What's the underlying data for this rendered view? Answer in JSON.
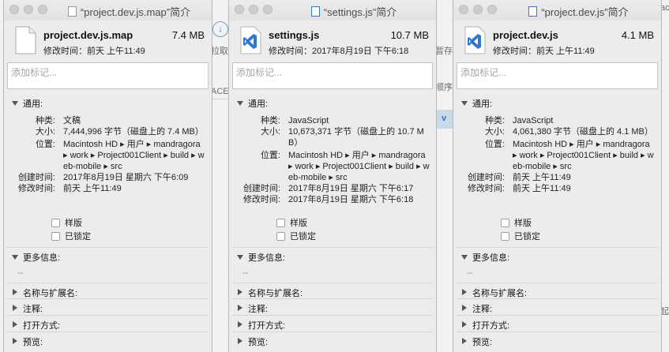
{
  "windows": [
    {
      "title": "“project.dev.js.map”简介",
      "icon": "blank-document-icon",
      "file_name": "project.dev.js.map",
      "file_size": "7.4 MB",
      "modified_line": "修改时间：前天 上午11:49",
      "tags_placeholder": "添加标记...",
      "general_label": "通用:",
      "kind_label": "种类:",
      "kind": "文稿",
      "size_label": "大小:",
      "size": "7,444,996 字节（磁盘上的 7.4 MB）",
      "where_label": "位置:",
      "where": "Macintosh HD ▸ 用户 ▸ mandragora ▸ work ▸ Project001Client ▸ build ▸ web-mobile ▸ src",
      "created_label": "创建时间:",
      "created": "2017年8月19日 星期六 下午6:09",
      "modified_label": "修改时间:",
      "modified": "前天 上午11:49",
      "stationery_label": "样版",
      "locked_label": "已锁定",
      "more_info_label": "更多信息:",
      "more_info_value": "--",
      "name_ext_label": "名称与扩展名:",
      "comments_label": "注释:",
      "open_with_label": "打开方式:",
      "preview_label": "预览:"
    },
    {
      "title": "“settings.js”简介",
      "icon": "vscode-icon",
      "file_name": "settings.js",
      "file_size": "10.7 MB",
      "modified_line": "修改时间：2017年8月19日 下午6:18",
      "tags_placeholder": "添加标记...",
      "general_label": "通用:",
      "kind_label": "种类:",
      "kind": "JavaScript",
      "size_label": "大小:",
      "size": "10,673,371 字节（磁盘上的 10.7 MB）",
      "where_label": "位置:",
      "where": "Macintosh HD ▸ 用户 ▸ mandragora ▸ work ▸ Project001Client ▸ build ▸ web-mobile ▸ src",
      "created_label": "创建时间:",
      "created": "2017年8月19日 星期六 下午6:17",
      "modified_label": "修改时间:",
      "modified": "2017年8月19日 星期六 下午6:18",
      "stationery_label": "样版",
      "locked_label": "已锁定",
      "more_info_label": "更多信息:",
      "more_info_value": "--",
      "name_ext_label": "名称与扩展名:",
      "comments_label": "注释:",
      "open_with_label": "打开方式:",
      "preview_label": "预览:"
    },
    {
      "title": "“project.dev.js”简介",
      "icon": "vscode-icon",
      "file_name": "project.dev.js",
      "file_size": "4.1 MB",
      "modified_line": "修改时间：前天 上午11:49",
      "tags_placeholder": "添加标记...",
      "general_label": "通用:",
      "kind_label": "种类:",
      "kind": "JavaScript",
      "size_label": "大小:",
      "size": "4,061,380 字节（磁盘上的 4.1 MB）",
      "where_label": "位置:",
      "where": "Macintosh HD ▸ 用户 ▸ mandragora ▸ work ▸ Project001Client ▸ build ▸ web-mobile ▸ src",
      "created_label": "创建时间:",
      "created": "前天 上午11:49",
      "modified_label": "修改时间:",
      "modified": "前天 上午11:49",
      "stationery_label": "样版",
      "locked_label": "已锁定",
      "more_info_label": "更多信息:",
      "more_info_value": "--",
      "name_ext_label": "名称与扩展名:",
      "comments_label": "注释:",
      "open_with_label": "打开方式:",
      "preview_label": "预览:"
    }
  ],
  "background": {
    "frag_pull": "拉取",
    "frag_ace": "ACE",
    "frag_save": "暂存",
    "frag_order": "顺序",
    "frag_v": "v",
    "frag_right": "ac",
    "frag_right2": "起"
  },
  "colors": {
    "vscode_blue": "#2d7ad0",
    "window_bg": "#ececec"
  }
}
